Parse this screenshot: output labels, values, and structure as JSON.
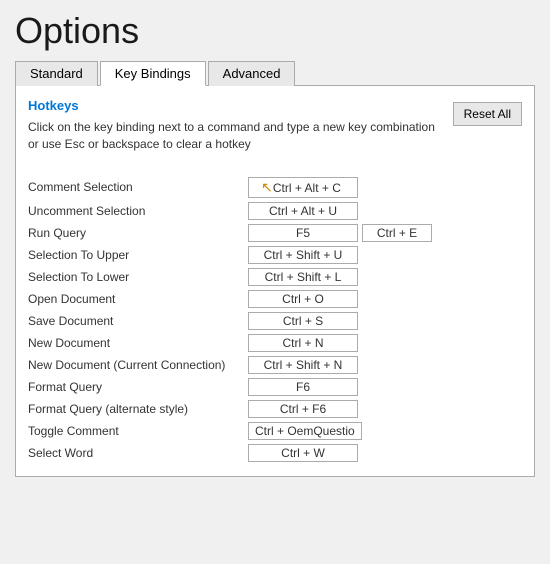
{
  "title": "Options",
  "tabs": [
    {
      "label": "Standard",
      "active": false
    },
    {
      "label": "Key Bindings",
      "active": true
    },
    {
      "label": "Advanced",
      "active": false
    }
  ],
  "section": {
    "title": "Hotkeys",
    "description": "Click on the key binding next to a command and type a new key combination or use Esc or backspace to clear a hotkey",
    "reset_button": "Reset All"
  },
  "bindings": [
    {
      "command": "Comment Selection",
      "key1": "Ctrl + Alt + C",
      "key2": null
    },
    {
      "command": "Uncomment Selection",
      "key1": "Ctrl + Alt + U",
      "key2": null
    },
    {
      "command": "Run Query",
      "key1": "F5",
      "key2": "Ctrl + E"
    },
    {
      "command": "Selection To Upper",
      "key1": "Ctrl + Shift + U",
      "key2": null
    },
    {
      "command": "Selection To Lower",
      "key1": "Ctrl + Shift + L",
      "key2": null
    },
    {
      "command": "Open Document",
      "key1": "Ctrl + O",
      "key2": null
    },
    {
      "command": "Save Document",
      "key1": "Ctrl + S",
      "key2": null
    },
    {
      "command": "New Document",
      "key1": "Ctrl + N",
      "key2": null
    },
    {
      "command": "New Document (Current Connection)",
      "key1": "Ctrl + Shift + N",
      "key2": null
    },
    {
      "command": "Format Query",
      "key1": "F6",
      "key2": null
    },
    {
      "command": "Format Query (alternate style)",
      "key1": "Ctrl + F6",
      "key2": null
    },
    {
      "command": "Toggle Comment",
      "key1": "Ctrl + OemQuestio",
      "key2": null
    },
    {
      "command": "Select Word",
      "key1": "Ctrl + W",
      "key2": null
    }
  ]
}
